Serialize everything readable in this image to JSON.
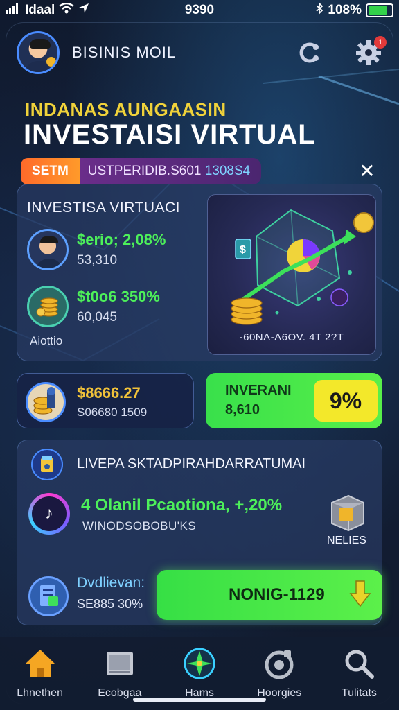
{
  "status_bar": {
    "carrier": "Idaal",
    "time": "9390",
    "battery": "108%",
    "battery_level": 0.85
  },
  "header": {
    "brand": "BISINIS MOIL",
    "notification_count": "1"
  },
  "hero": {
    "subtitle": "INDANAS AUNGAASIN",
    "title": "INVESTAISI VIRTUAL",
    "chip_tag": "SETM",
    "chip_text": "USTPERIDIB.S601",
    "chip_highlight": "1308Ѕ4",
    "close_label": "✕"
  },
  "main_card": {
    "title": "INVESTISA VIRTUACI",
    "items": [
      {
        "label": "$erio; 2,08%",
        "value": "53,310"
      },
      {
        "label": "$t0o6 350%",
        "value": "60,045"
      }
    ],
    "footer": "Aiottio",
    "graphic_caption": "-60NA-A6OV. 4T 2?T"
  },
  "balance_card": {
    "amount": "$8666.27",
    "sub": "S06680 1509"
  },
  "invest_card": {
    "label": "INVERANI",
    "value": "8,610",
    "percent": "9%"
  },
  "lower_card": {
    "title": "LIVEPA SKTADPIRAHDARRATUMAI",
    "primary": "4 Olanil Pcaotiona, +,20%",
    "primary_sub": "WINODSOBOBU'KS",
    "box_label": "NELIES",
    "doc_title": "Dvdlievan:",
    "doc_sub": "SE885 30%",
    "cta_label": "NONIG-1129"
  },
  "nav": [
    {
      "label": "Lhnethen",
      "icon": "home-icon"
    },
    {
      "label": "Ecobgaa",
      "icon": "folder-icon"
    },
    {
      "label": "Hams",
      "icon": "compass-icon"
    },
    {
      "label": "Hoorgies",
      "icon": "target-icon"
    },
    {
      "label": "Tulitats",
      "icon": "search-icon"
    }
  ],
  "colors": {
    "accent_green": "#4df05a",
    "accent_yellow": "#f0d23a",
    "accent_blue": "#4a8cff",
    "background": "#111a2c"
  }
}
